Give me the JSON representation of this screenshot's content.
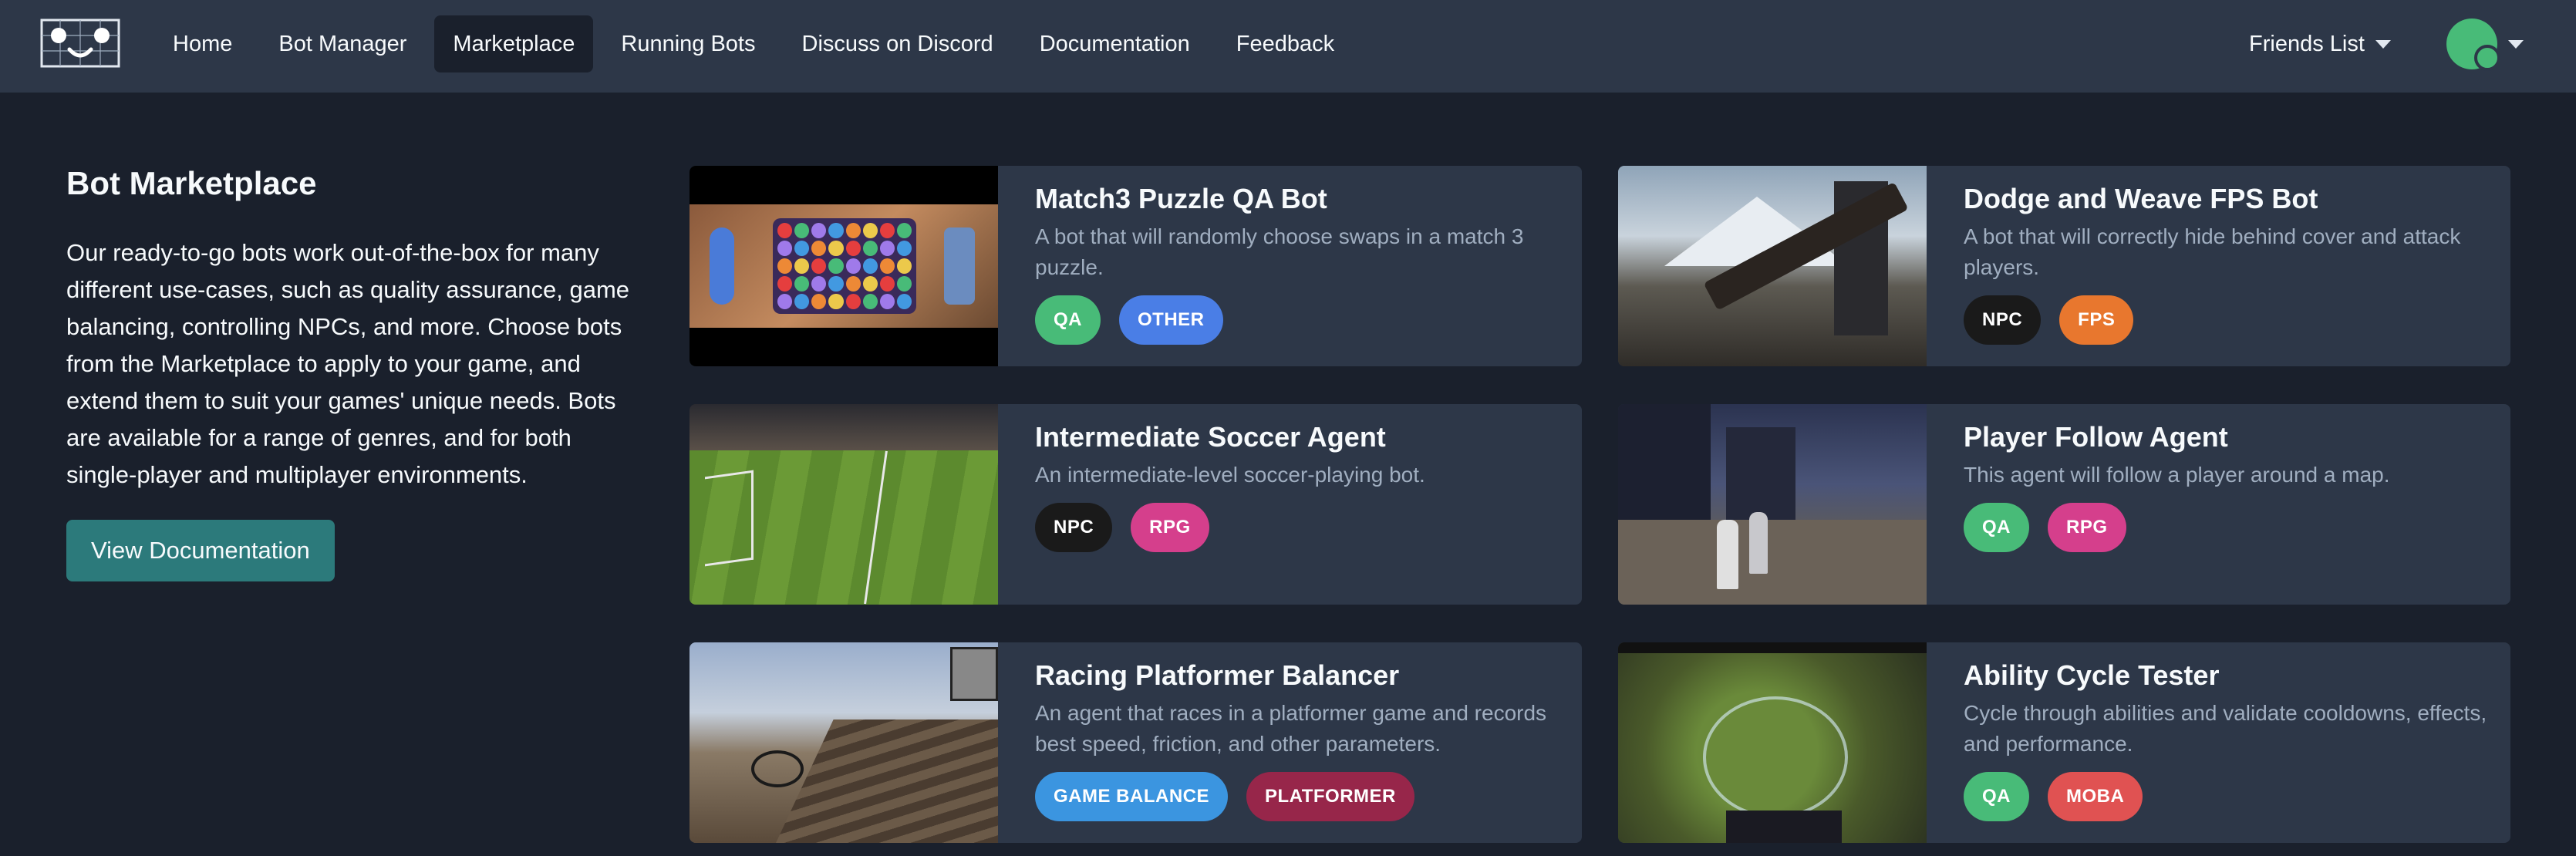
{
  "nav": {
    "links": [
      "Home",
      "Bot Manager",
      "Marketplace",
      "Running Bots",
      "Discuss on Discord",
      "Documentation",
      "Feedback"
    ],
    "active": "Marketplace",
    "friends_label": "Friends List"
  },
  "intro": {
    "title": "Bot Marketplace",
    "body": "Our ready-to-go bots work out-of-the-box for many different use-cases, such as quality assurance, game balancing, controlling NPCs, and more. Choose bots from the Marketplace to apply to your game, and extend them to suit your games' unique needs. Bots are available for a range of genres, and for both single-player and multiplayer environments.",
    "button": "View Documentation"
  },
  "colors": {
    "QA": "#48bb78",
    "OTHER": "#4a7ee6",
    "NPC": "#1a1a1a",
    "FPS": "#e8772e",
    "RPG": "#d53f8c",
    "GAME BALANCE": "#3b95e0",
    "PLATFORMER": "#97264a",
    "MOBA": "#e05252"
  },
  "cards": [
    {
      "title": "Match3 Puzzle QA Bot",
      "desc": "A bot that will randomly choose swaps in a match 3 puzzle.",
      "tags": [
        "QA",
        "OTHER"
      ],
      "thumb": "match3"
    },
    {
      "title": "Dodge and Weave FPS Bot",
      "desc": "A bot that will correctly hide behind cover and attack players.",
      "tags": [
        "NPC",
        "FPS"
      ],
      "thumb": "fps"
    },
    {
      "title": "Intermediate Soccer Agent",
      "desc": "An intermediate-level soccer-playing bot.",
      "tags": [
        "NPC",
        "RPG"
      ],
      "thumb": "soccer"
    },
    {
      "title": "Player Follow Agent",
      "desc": "This agent will follow a player around a map.",
      "tags": [
        "QA",
        "RPG"
      ],
      "thumb": "follow"
    },
    {
      "title": "Racing Platformer Balancer",
      "desc": "An agent that races in a platformer game and records best speed, friction, and other parameters.",
      "tags": [
        "GAME BALANCE",
        "PLATFORMER"
      ],
      "thumb": "racing"
    },
    {
      "title": "Ability Cycle Tester",
      "desc": "Cycle through abilities and validate cooldowns, effects, and performance.",
      "tags": [
        "QA",
        "MOBA"
      ],
      "thumb": "moba"
    }
  ]
}
